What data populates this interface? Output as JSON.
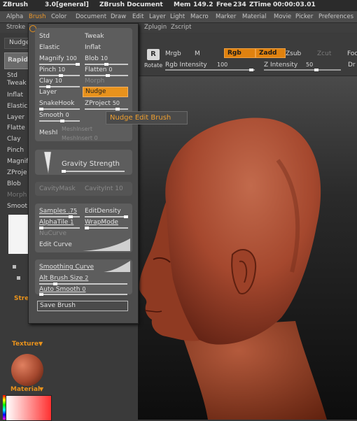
{
  "title_bar": {
    "app": "ZBrush",
    "version": "3.0[general]",
    "document": "ZBrush Document",
    "mem_label": "Mem",
    "mem_value": "149.2",
    "free_label": "Free",
    "free_value": "234",
    "ztime_label": "ZTime",
    "ztime_value": "00:00:03.01"
  },
  "menu": [
    "Alpha",
    "Brush",
    "Color",
    "Document",
    "Draw",
    "Edit",
    "Layer",
    "Light",
    "Macro",
    "Marker",
    "Material",
    "Movie",
    "Picker",
    "Preferences"
  ],
  "menu_active": "Brush",
  "bar2": [
    "Stroke",
    "Zplugin",
    "Zscript"
  ],
  "toolbar": {
    "mrgb": "Mrgb",
    "m": "M",
    "rgb": "Rgb",
    "zadd": "Zadd",
    "zsub": "Zsub",
    "zcut": "Zcut",
    "foc": "Foc",
    "rotate": "Rotate",
    "rgb_intensity_label": "Rgb Intensity",
    "rgb_intensity": "100",
    "z_intensity_label": "Z Intensity",
    "z_intensity": "50",
    "dr": "Dr"
  },
  "left_tray": {
    "nudge": "Nudge",
    "rapid": "Rapid",
    "items": [
      "Std",
      "Tweak",
      "Inflat",
      "Elastic",
      "Layer",
      "Flatte",
      "Clay",
      "Pinch",
      "Magnif",
      "ZProje",
      "Blob",
      "Morph",
      "Smoot"
    ],
    "stre": "Stre",
    "texture": "Texture",
    "material": "Material"
  },
  "palette": {
    "brushes": {
      "std": "Std",
      "tweak": "Tweak",
      "elastic": "Elastic",
      "inflat": "Inflat",
      "magnify": "Magnify",
      "magnify_val": "100",
      "blob": "Blob",
      "blob_val": "10",
      "pinch": "Pinch",
      "pinch_val": "10",
      "flatten": "Flatten",
      "flatten_val": "0",
      "clay": "Clay",
      "clay_val": "10",
      "morph": "Morph",
      "layer": "Layer",
      "nudge": "Nudge",
      "snakehook": "SnakeHook",
      "zproject": "ZProject",
      "zproject_val": "50",
      "smooth": "Smooth",
      "smooth_val": "0",
      "meshi": "MeshI",
      "meshinsert": "MeshInsert",
      "meshinsert_val": "0"
    },
    "gravity_label": "Gravity Strength",
    "cavity_mask": "CavityMask",
    "cavity_int": "CavityInt",
    "cavity_val": "10",
    "samples_label": "Samples",
    "samples_val": ".75",
    "edit_density": "EditDensity",
    "alpha_tile_label": "AlphaTile",
    "alpha_tile_val": "1",
    "wrap_mode": "WrapMode",
    "nu_curve": "NuCurve",
    "edit_curve": "Edit Curve",
    "smoothing_curve": "Smoothing Curve",
    "alt_brush_label": "Alt Brush Size",
    "alt_brush_val": "2",
    "auto_smooth_label": "Auto Smooth",
    "auto_smooth_val": "0",
    "save_brush": "Save Brush"
  },
  "tooltip": "Nudge Edit Brush",
  "colors": {
    "accent": "#e8921c",
    "skin": "#a5482e",
    "panel": "#4c4c4c"
  }
}
